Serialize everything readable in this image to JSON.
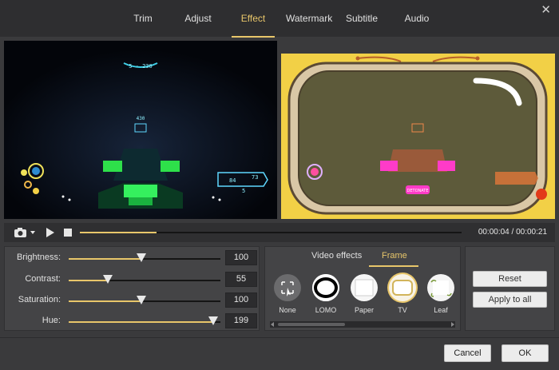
{
  "tabs": [
    {
      "label": "Trim",
      "active": false
    },
    {
      "label": "Adjust",
      "active": false
    },
    {
      "label": "Effect",
      "active": true
    },
    {
      "label": "Watermark",
      "active": false
    },
    {
      "label": "Subtitle",
      "active": false
    },
    {
      "label": "Audio",
      "active": false
    }
  ],
  "close_label": "✕",
  "playback": {
    "current_time": "00:00:04",
    "total_time": "00:00:21",
    "time_display": "00:00:04 / 00:00:21",
    "progress": 0.2
  },
  "adjust": {
    "brightness": {
      "label": "Brightness:",
      "value": "100",
      "level": 0.48
    },
    "contrast": {
      "label": "Contrast:",
      "value": "55",
      "level": 0.26
    },
    "saturation": {
      "label": "Saturation:",
      "value": "100",
      "level": 0.48
    },
    "hue": {
      "label": "Hue:",
      "value": "199",
      "level": 0.95
    }
  },
  "effect_tabs": {
    "video_effects": "Video effects",
    "frame": "Frame",
    "active": "Frame"
  },
  "frames": [
    {
      "label": "None",
      "icon": "none-frame-icon"
    },
    {
      "label": "LOMO",
      "icon": "lomo-frame-icon"
    },
    {
      "label": "Paper",
      "icon": "paper-frame-icon"
    },
    {
      "label": "TV",
      "icon": "tv-frame-icon",
      "selected": true
    },
    {
      "label": "Leaf",
      "icon": "leaf-frame-icon"
    }
  ],
  "buttons": {
    "reset": "Reset",
    "apply_all": "Apply to all",
    "cancel": "Cancel",
    "ok": "OK"
  },
  "colors": {
    "accent": "#e8c66a",
    "background": "#3a3a3c",
    "tv_frame_bg": "#f2d046"
  },
  "hud": {
    "top_readout": "5 - 230",
    "mid_readout": "430",
    "right_readout_a": "73",
    "right_readout_b": "84",
    "right_readout_c": "5",
    "preview_badge": "DETONATE"
  }
}
